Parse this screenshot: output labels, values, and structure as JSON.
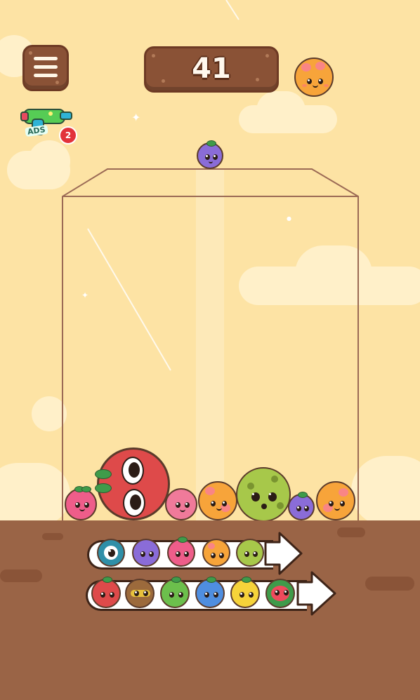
{
  "score": "41",
  "next_fruit": "grapefruit",
  "dropping_fruit": "blueberry",
  "powerup": {
    "label": "ADS",
    "count": "2",
    "icon": "water-gun-icon"
  },
  "colors": {
    "sky": "#fde3a4",
    "ground": "#9a6446",
    "wood": "#8a5236",
    "container_outline": "#9b6a55"
  },
  "container_fruits": [
    "strawberry",
    "tomato",
    "peach",
    "grapefruit",
    "kiwi",
    "blueberry",
    "grapefruit"
  ],
  "evolution_row_1": [
    "blueberry-teal",
    "blueberry",
    "strawberry",
    "grapefruit",
    "kiwi"
  ],
  "evolution_row_2": [
    "tomato",
    "coconut",
    "lime",
    "plum",
    "lemon",
    "watermelon"
  ]
}
